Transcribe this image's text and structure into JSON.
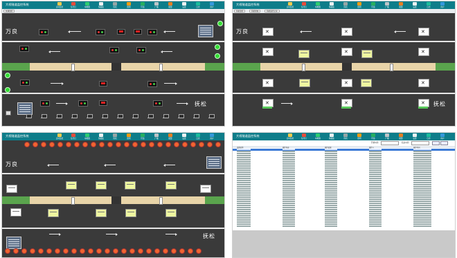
{
  "app_title": "大桥隧道监控系统",
  "nav_items": [
    {
      "label": "实时监控",
      "icon": "monitor-icon",
      "color": "#f2c94c"
    },
    {
      "label": "信号灯",
      "icon": "traffic-light-icon",
      "color": "#e74c3c"
    },
    {
      "label": "车检器",
      "icon": "detector-icon",
      "color": "#2ecc71"
    },
    {
      "label": "情报板",
      "icon": "board-icon",
      "color": "#ecf0f1"
    },
    {
      "label": "风机",
      "icon": "fan-icon",
      "color": "#95a5a6"
    },
    {
      "label": "照明",
      "icon": "light-icon",
      "color": "#f39c12"
    },
    {
      "label": "环境",
      "icon": "environment-icon",
      "color": "#27ae60"
    },
    {
      "label": "广播",
      "icon": "broadcast-icon",
      "color": "#bdc3c7"
    },
    {
      "label": "报警",
      "icon": "alarm-icon",
      "color": "#e67e22"
    },
    {
      "label": "设置",
      "icon": "settings-icon",
      "color": "#ecf0f1"
    },
    {
      "label": "日志",
      "icon": "log-icon",
      "color": "#1abc9c"
    },
    {
      "label": "用户",
      "icon": "user-icon",
      "color": "#3498db"
    }
  ],
  "top_left": {
    "subtabs": [
      "交通监控"
    ],
    "place_top": "万良",
    "place_bottom": "抚松"
  },
  "top_right": {
    "subtabs": [
      "风机监控",
      "风机状态",
      "风机运行记录"
    ],
    "place_top": "万良",
    "place_bottom": "抚松"
  },
  "bottom_left": {
    "place_top": "万良",
    "place_bottom": "抚松"
  },
  "bottom_right": {
    "filters": [
      "开始时间",
      "结束时间",
      "设备名称"
    ],
    "columns": [
      "设备名称",
      "操作内容",
      "操作结果",
      "操作人",
      "操作时间"
    ]
  },
  "colors": {
    "titlebar": "#0e7d8a",
    "road": "#3a3a3a",
    "median_sand": "#e8d4a8",
    "grass": "#5aa44d",
    "selected_row": "#3b7ad6"
  }
}
